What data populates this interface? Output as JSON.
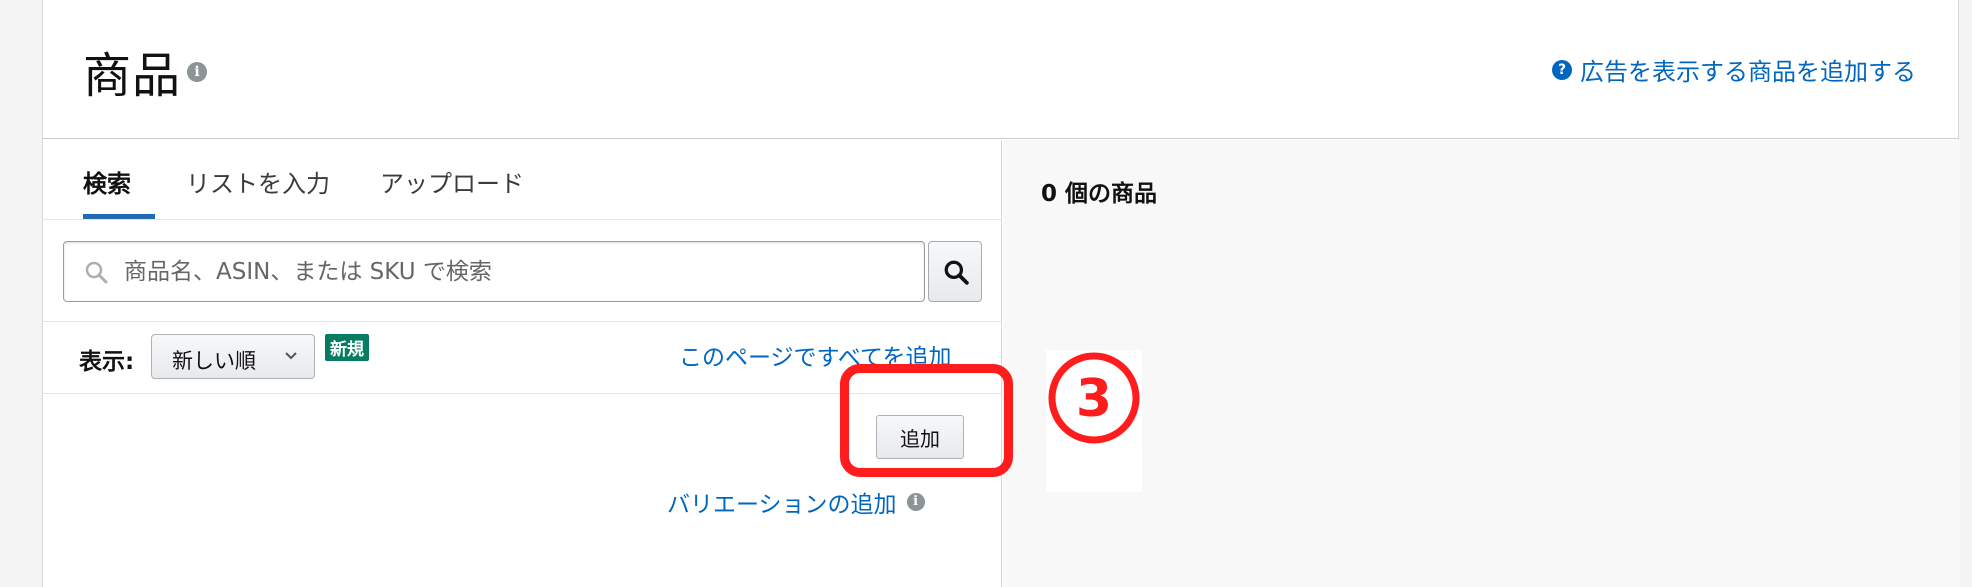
{
  "header": {
    "title": "商品",
    "help_link": "広告を表示する商品を追加する"
  },
  "tabs": [
    {
      "label": "検索"
    },
    {
      "label": "リストを入力"
    },
    {
      "label": "アップロード"
    }
  ],
  "search": {
    "placeholder": "商品名、ASIN、または SKU で検索"
  },
  "display": {
    "label": "表示:",
    "sort_value": "新しい順",
    "new_badge": "新規",
    "add_all_link": "このページですべてを追加"
  },
  "add_button": "追加",
  "variation_link": "バリエーションの追加",
  "right": {
    "count_text": "0 個の商品"
  },
  "annotation": {
    "marker_number": "3",
    "color": "#ff1c1c"
  },
  "colors": {
    "link": "#0066c0",
    "tab_underline": "#236ab0",
    "badge": "#067d62"
  }
}
